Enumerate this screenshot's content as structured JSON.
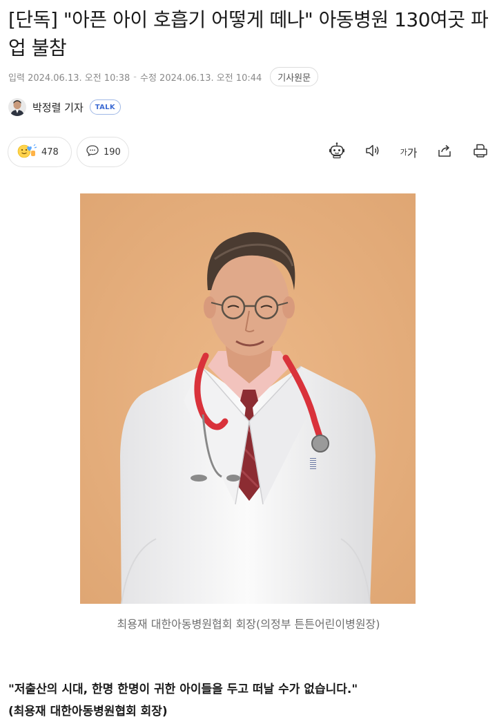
{
  "headline": "[단독] \"아픈 아이 호흡기 어떻게 떼나\" 아동병원 130여곳 파업 불참",
  "meta": {
    "input_label": "입력",
    "input_time": "2024.06.13. 오전 10:38",
    "separator": "-",
    "modified_label": "수정",
    "modified_time": "2024.06.13. 오전 10:44",
    "original_button": "기사원문"
  },
  "byline": {
    "reporter": "박정렬 기자",
    "talk_label": "TALK"
  },
  "reactions": {
    "reaction_count": "478",
    "comment_count": "190"
  },
  "tools": {
    "font_size_small": "가",
    "font_size_big": "가"
  },
  "photo": {
    "caption": "최용재 대한아동병원협회 회장(의정부 튼튼어린이병원장)",
    "background_color": "#e7b07e",
    "coat_color": "#f7f7f7",
    "stethoscope_color": "#d9323b"
  },
  "body": {
    "quote": "\"저출산의 시대, 한명 한명이 귀한 아이들을 두고 떠날 수가 없습니다.\"",
    "quote_attribution": "(최용재 대한아동병원협회 회장)"
  }
}
